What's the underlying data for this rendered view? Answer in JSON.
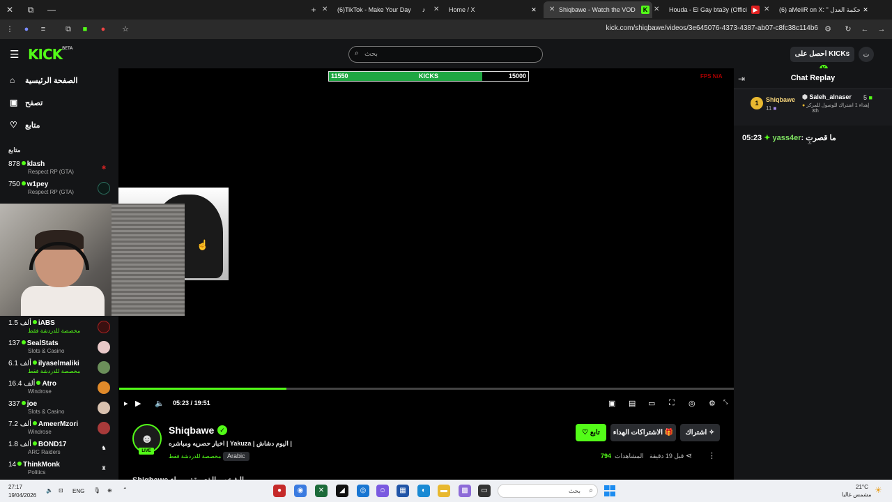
{
  "browser": {
    "window_controls": [
      "✕",
      "⧉",
      "—"
    ],
    "tabs": [
      {
        "title": "(6)TikTok - Make Your Day",
        "active": false
      },
      {
        "title": "Home / X",
        "active": false
      },
      {
        "title": "Shiqbawe - Watch the VOD on",
        "active": true
      },
      {
        "title": "Houda - El Gay bta3y (Official L",
        "active": false
      },
      {
        "title": "(6) aMeiiR on X: \" حكمة العدل",
        "active": false
      }
    ],
    "url": "kick.com/shiqbawe/videos/3e645076-4373-4387-ab07-c8fc38c114b6"
  },
  "kick_header": {
    "logo": "KICK",
    "logo_badge": "BETA",
    "search_placeholder": "بحث",
    "get_kicks_label": "احصل على KICKs",
    "profile_initial": "ت"
  },
  "sidebar": {
    "nav": [
      {
        "label": "الصفحة الرئيسية",
        "icon": "home-icon"
      },
      {
        "label": "تصفح",
        "icon": "browse-icon"
      },
      {
        "label": "متابع",
        "icon": "heart-icon"
      }
    ],
    "following_header": "متابع",
    "channels": [
      {
        "views": "878",
        "name": "klash",
        "category": "Respect RP (GTA)"
      },
      {
        "views": "750",
        "name": "w1pey",
        "category": "Respect RP (GTA)"
      },
      {
        "views": "1.5 ألف",
        "name": "iABS",
        "category": "مخصصة للدردشة فقط"
      },
      {
        "views": "137",
        "name": "SealStats",
        "category": "Slots & Casino"
      },
      {
        "views": "6.1 ألف",
        "name": "ilyaselmaliki",
        "category": "مخصصة للدردشة فقط"
      },
      {
        "views": "16.4 ألف",
        "name": "Atro",
        "category": "Windrose"
      },
      {
        "views": "337",
        "name": "joe",
        "category": "Slots & Casino"
      },
      {
        "views": "7.2 ألف",
        "name": "AmeerMzori",
        "category": "Windrose"
      },
      {
        "views": "1.8 ألف",
        "name": "BOND17",
        "category": "ARC Raiders"
      },
      {
        "views": "14",
        "name": "ThinkMonk",
        "category": "Politics"
      }
    ]
  },
  "video": {
    "kicks_goal": {
      "current": "11550",
      "label": "KICKS",
      "target": "15000",
      "fraction": 0.77
    },
    "fps_overlay": "FPS N/A",
    "progress_fraction": 0.272,
    "current_time": "05:23",
    "time_separator": "/",
    "duration": "19:51"
  },
  "channel": {
    "name": "Shiqbawe",
    "live_badge": "LIVE",
    "stream_title": "اخبار حصريه ومباشره | Yakuza | اليوم دشاش |",
    "category": "مخصصة للدردشة فقط",
    "language": "Arabic",
    "follow_label": "تابع",
    "gift_label": "الاشتراكات الهداء",
    "subscribe_label": "اشتراك",
    "viewers_count": "794",
    "viewers_label": "المشاهدات",
    "ago": "قبل 19 دقيقة",
    "about_heading": "Shiqbawe الشخص الذي يقف وراء"
  },
  "chat": {
    "title": "Chat Replay",
    "pinned": {
      "rank": "1",
      "top_user": "Shiqbawe",
      "top_user_count": "11",
      "gifter": "Saleh_alnaser",
      "gift_count": "5",
      "description": "إهداء 1 اشتراك للوصول للمركز",
      "place": "3th"
    },
    "messages": [
      {
        "time": "05:23",
        "user": "yass4er",
        "text": "ما قصرت"
      }
    ]
  },
  "taskbar": {
    "clock_time": "27:17",
    "clock_date": "19/04/2026",
    "lang": "ENG",
    "search_placeholder": "بحث",
    "weather_temp": "21°C",
    "weather_desc": "مشمس غالبا"
  },
  "colors": {
    "kick_green": "#53fc18",
    "bg_dark": "#141517",
    "goal_fill": "#1fa642"
  }
}
